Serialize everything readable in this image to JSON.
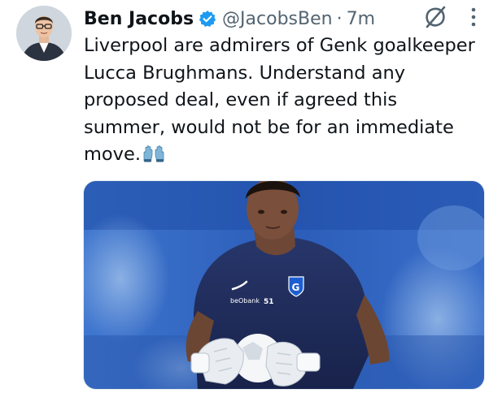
{
  "tweet": {
    "author": {
      "display_name": "Ben Jacobs",
      "handle": "@JacobsBen",
      "verified_icon": "verified-badge-icon",
      "avatar_icon": "avatar"
    },
    "separator": "·",
    "time": "7m",
    "grok_icon": "grok-icon",
    "more_icon": "more-options-icon",
    "text_lines": [
      "Liverpool are admirers of Genk goalkeeper",
      "Lucca Brughmans. Understand any",
      "proposed deal, even if agreed this",
      "summer, would not be for an immediate",
      "move."
    ],
    "emoji": "gloves-emoji",
    "media": {
      "shirt_sponsor": "beObank",
      "shirt_number": "51",
      "crest_letter": "G"
    }
  },
  "colors": {
    "primary_text": "#0f1419",
    "secondary_text": "#536471",
    "verified_blue": "#1d9bf0",
    "kit_navy": "#1e2a55",
    "stadium_blue": "#2f63c6"
  }
}
